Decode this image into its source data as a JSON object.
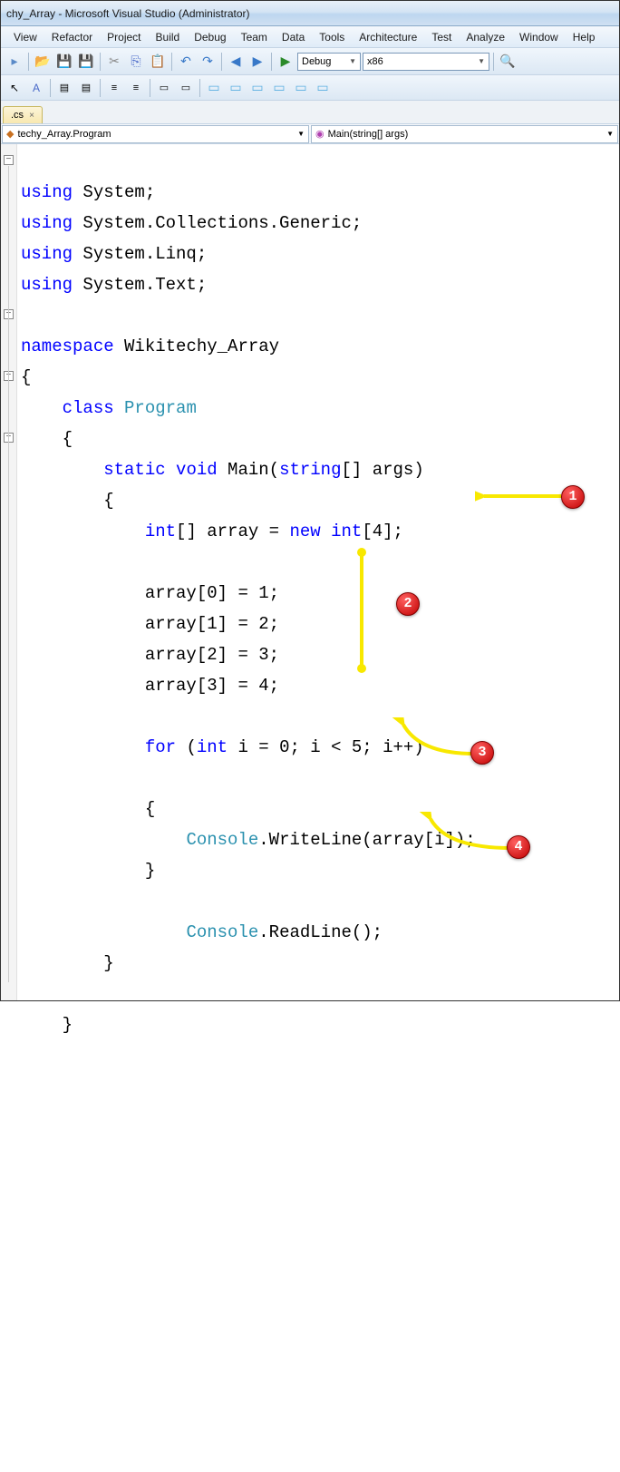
{
  "window": {
    "title": "chy_Array - Microsoft Visual Studio (Administrator)"
  },
  "menu": {
    "items": [
      "View",
      "Refactor",
      "Project",
      "Build",
      "Debug",
      "Team",
      "Data",
      "Tools",
      "Architecture",
      "Test",
      "Analyze",
      "Window",
      "Help"
    ]
  },
  "toolbar": {
    "config": "Debug",
    "platform": "x86"
  },
  "tab": {
    "label": ".cs",
    "close": "×"
  },
  "nav": {
    "left": "techy_Array.Program",
    "right": "Main(string[] args)"
  },
  "code": {
    "l1_kw": "using",
    "l1_t": " System;",
    "l2_kw": "using",
    "l2_t": " System.Collections.Generic;",
    "l3_kw": "using",
    "l3_t": " System.Linq;",
    "l4_kw": "using",
    "l4_t": " System.Text;",
    "l5": "",
    "l6_kw": "namespace",
    "l6_t": " Wikitechy_Array",
    "l7": "{",
    "l8a": "    ",
    "l8_kw": "class",
    "l8b": " ",
    "l8_type": "Program",
    "l9": "    {",
    "l10a": "        ",
    "l10_kw1": "static",
    "l10b": " ",
    "l10_kw2": "void",
    "l10c": " Main(",
    "l10_kw3": "string",
    "l10d": "[] args)",
    "l11": "        {",
    "l12a": "            ",
    "l12_kw1": "int",
    "l12b": "[] array = ",
    "l12_kw2": "new",
    "l12c": " ",
    "l12_kw3": "int",
    "l12d": "[4];",
    "l13": "",
    "l14": "            array[0] = 1;",
    "l15": "            array[1] = 2;",
    "l16": "            array[2] = 3;",
    "l17": "            array[3] = 4;",
    "l18": "",
    "l19a": "            ",
    "l19_kw": "for",
    "l19b": " (",
    "l19_kw2": "int",
    "l19c": " i = 0; i < 5; i++)",
    "l20": "",
    "l21": "            {",
    "l22a": "                ",
    "l22_type": "Console",
    "l22b": ".WriteLine(array[i]);",
    "l23": "            }",
    "l24": "",
    "l25a": "                ",
    "l25_type": "Console",
    "l25b": ".ReadLine();",
    "l26": "        }",
    "l27": "",
    "l28": "    }"
  },
  "callouts": {
    "c1": "1",
    "c2": "2",
    "c3": "3",
    "c4": "4"
  }
}
